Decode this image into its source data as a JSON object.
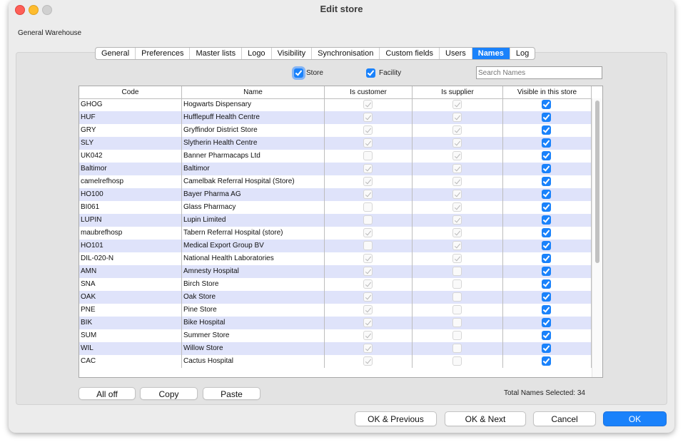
{
  "window": {
    "title": "Edit store",
    "store_name": "General Warehouse"
  },
  "tabs": [
    "General",
    "Preferences",
    "Master lists",
    "Logo",
    "Visibility",
    "Synchronisation",
    "Custom fields",
    "Users",
    "Names",
    "Log"
  ],
  "active_tab": "Names",
  "filters": {
    "store_label": "Store",
    "store_checked": true,
    "facility_label": "Facility",
    "facility_checked": true
  },
  "search": {
    "placeholder": "Search Names",
    "value": ""
  },
  "table": {
    "columns": [
      "Code",
      "Name",
      "Is customer",
      "Is supplier",
      "Visible in this store"
    ],
    "rows": [
      {
        "code": "GHOG",
        "name": "Hogwarts Dispensary",
        "customer": true,
        "supplier": true,
        "visible": true
      },
      {
        "code": "HUF",
        "name": "Hufflepuff Health Centre",
        "customer": true,
        "supplier": true,
        "visible": true
      },
      {
        "code": "GRY",
        "name": "Gryffindor District Store",
        "customer": true,
        "supplier": true,
        "visible": true
      },
      {
        "code": "SLY",
        "name": "Slytherin Health Centre",
        "customer": true,
        "supplier": true,
        "visible": true
      },
      {
        "code": "UK042",
        "name": "Banner Pharmacaps Ltd",
        "customer": false,
        "supplier": true,
        "visible": true
      },
      {
        "code": "Baltimor",
        "name": "Baltimor",
        "customer": true,
        "supplier": true,
        "visible": true
      },
      {
        "code": "camelrefhosp",
        "name": "Camelbak Referral Hospital (Store)",
        "customer": true,
        "supplier": true,
        "visible": true
      },
      {
        "code": "HO100",
        "name": "Bayer Pharma AG",
        "customer": true,
        "supplier": true,
        "visible": true
      },
      {
        "code": "BI061",
        "name": "Glass Pharmacy",
        "customer": false,
        "supplier": true,
        "visible": true
      },
      {
        "code": "LUPIN",
        "name": "Lupin Limited",
        "customer": false,
        "supplier": true,
        "visible": true
      },
      {
        "code": "maubrefhosp",
        "name": "Tabern Referral Hospital (store)",
        "customer": true,
        "supplier": true,
        "visible": true
      },
      {
        "code": "HO101",
        "name": "Medical Export Group BV",
        "customer": false,
        "supplier": true,
        "visible": true
      },
      {
        "code": "DIL-020-N",
        "name": "National Health Laboratories",
        "customer": true,
        "supplier": true,
        "visible": true
      },
      {
        "code": "AMN",
        "name": "Amnesty Hospital",
        "customer": true,
        "supplier": false,
        "visible": true
      },
      {
        "code": "SNA",
        "name": "Birch Store",
        "customer": true,
        "supplier": false,
        "visible": true
      },
      {
        "code": "OAK",
        "name": "Oak Store",
        "customer": true,
        "supplier": false,
        "visible": true
      },
      {
        "code": "PNE",
        "name": "Pine Store",
        "customer": true,
        "supplier": false,
        "visible": true
      },
      {
        "code": "BIK",
        "name": "Bike Hospital",
        "customer": true,
        "supplier": false,
        "visible": true
      },
      {
        "code": "SUM",
        "name": "Summer Store",
        "customer": true,
        "supplier": false,
        "visible": true
      },
      {
        "code": "WIL",
        "name": "Willow Store",
        "customer": true,
        "supplier": false,
        "visible": true
      },
      {
        "code": "CAC",
        "name": "Cactus Hospital",
        "customer": true,
        "supplier": false,
        "visible": true
      }
    ]
  },
  "buttons": {
    "all_off": "All off",
    "copy": "Copy",
    "paste": "Paste",
    "ok_previous": "OK & Previous",
    "ok_next": "OK & Next",
    "cancel": "Cancel",
    "ok": "OK"
  },
  "total": {
    "label": "Total Names Selected:",
    "value": "34"
  },
  "colors": {
    "accent": "#1a82fb",
    "row_alt": "#dfe3fa",
    "window_bg": "#ececec"
  }
}
